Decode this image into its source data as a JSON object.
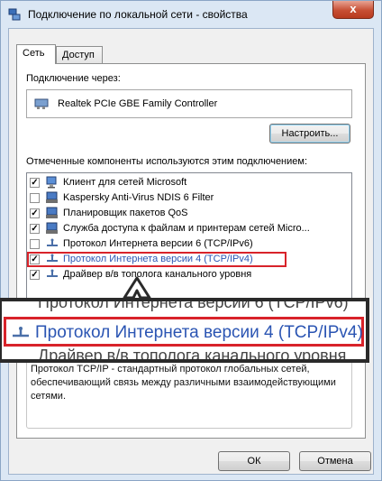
{
  "window": {
    "title": "Подключение по локальной сети - свойства",
    "close_label": "x"
  },
  "tabs": [
    {
      "label": "Сеть",
      "active": true
    },
    {
      "label": "Доступ",
      "active": false
    }
  ],
  "connect_using": {
    "label": "Подключение через:",
    "adapter": "Realtek PCIe GBE Family Controller"
  },
  "configure_button": "Настроить...",
  "components": {
    "label": "Отмеченные компоненты используются этим подключением:",
    "items": [
      {
        "label": "Клиент для сетей Microsoft",
        "checked": true,
        "icon": "network-client-icon"
      },
      {
        "label": "Kaspersky Anti-Virus NDIS 6 Filter",
        "checked": false,
        "icon": "network-service-icon"
      },
      {
        "label": "Планировщик пакетов QoS",
        "checked": true,
        "icon": "network-service-icon"
      },
      {
        "label": "Служба доступа к файлам и принтерам сетей Micro...",
        "checked": true,
        "icon": "network-service-icon"
      },
      {
        "label": "Протокол Интернета версии 6 (TCP/IPv6)",
        "checked": false,
        "icon": "protocol-icon"
      },
      {
        "label": "Протокол Интернета версии 4 (TCP/IPv4)",
        "checked": true,
        "icon": "protocol-icon",
        "selected": true
      },
      {
        "label": "Драйвер в/в тополога канального уровня",
        "checked": true,
        "icon": "protocol-icon"
      }
    ]
  },
  "zoom": {
    "above": "Протокол Интернета версии 6 (TCP/IPv6)",
    "selected": "Протокол Интернета версии 4 (TCP/IPv4)",
    "below": "Драйвер в/в тополога канального уровня"
  },
  "description": "Протокол TCP/IP - стандартный протокол глобальных сетей, обеспечивающий связь между различными взаимодействующими сетями.",
  "buttons": {
    "ok": "ОК",
    "cancel": "Отмена"
  },
  "colors": {
    "selection_text": "#2b55b3",
    "highlight_border": "#d8232a"
  }
}
